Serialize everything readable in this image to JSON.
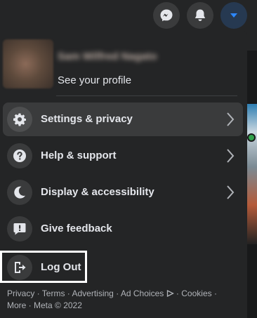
{
  "topbar": {
    "messenger_icon": "messenger-icon",
    "notifications_icon": "bell-icon",
    "account_icon": "caret-down-icon"
  },
  "profile": {
    "name": "Sam Wilfred Nagato",
    "subtitle": "See your profile"
  },
  "menu": {
    "items": [
      {
        "label": "Settings & privacy",
        "icon": "gear-icon"
      },
      {
        "label": "Help & support",
        "icon": "question-icon"
      },
      {
        "label": "Display & accessibility",
        "icon": "moon-icon"
      },
      {
        "label": "Give feedback",
        "icon": "feedback-icon"
      },
      {
        "label": "Log Out",
        "icon": "logout-icon"
      }
    ]
  },
  "footer": {
    "privacy": "Privacy",
    "terms": "Terms",
    "advertising": "Advertising",
    "ad_choices": "Ad Choices",
    "cookies": "Cookies",
    "more": "More",
    "meta": "Meta © 2022"
  },
  "colors": {
    "panel": "#242526",
    "page_bg": "#18191a",
    "accent": "#2d88ff",
    "hover": "#3a3b3c",
    "text": "#e4e6eb",
    "muted": "#b0b3b8"
  }
}
